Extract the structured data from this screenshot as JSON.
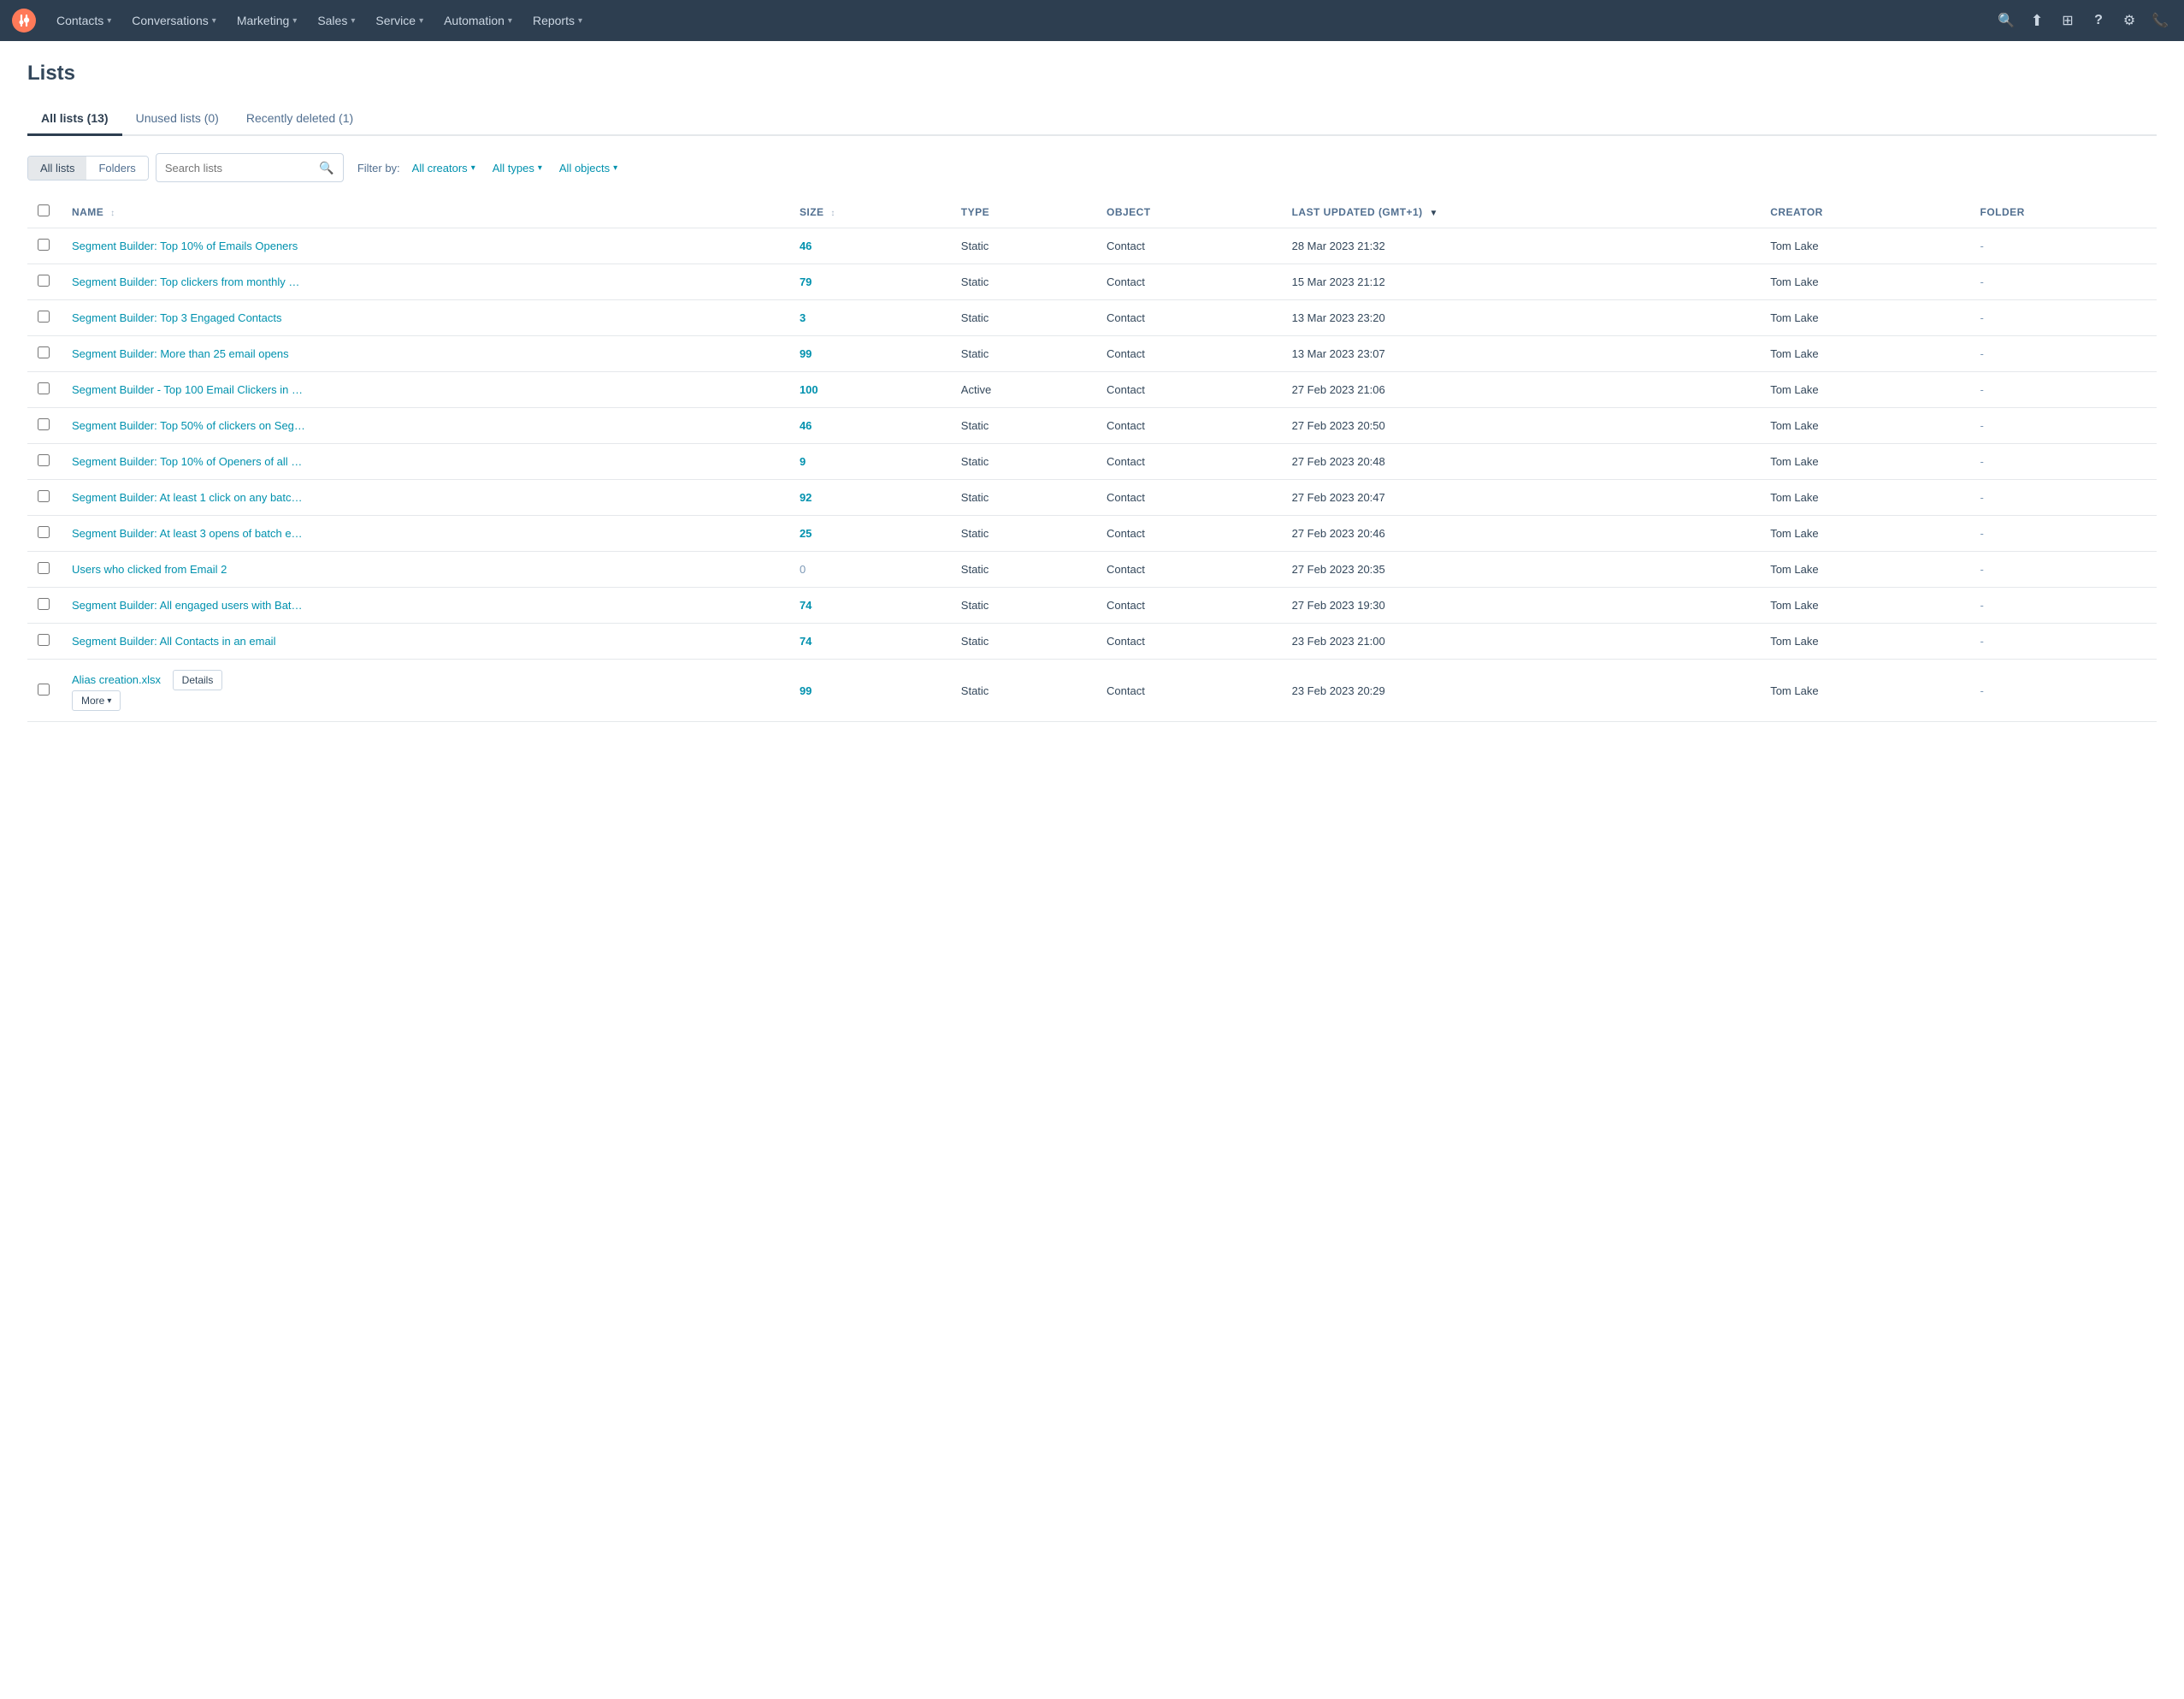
{
  "nav": {
    "logo_title": "HubSpot",
    "items": [
      {
        "label": "Contacts",
        "has_dropdown": true
      },
      {
        "label": "Conversations",
        "has_dropdown": true
      },
      {
        "label": "Marketing",
        "has_dropdown": true
      },
      {
        "label": "Sales",
        "has_dropdown": true
      },
      {
        "label": "Service",
        "has_dropdown": true
      },
      {
        "label": "Automation",
        "has_dropdown": true
      },
      {
        "label": "Reports",
        "has_dropdown": true
      }
    ],
    "icons": [
      {
        "name": "search-icon",
        "symbol": "🔍"
      },
      {
        "name": "upgrade-icon",
        "symbol": "⬆"
      },
      {
        "name": "marketplace-icon",
        "symbol": "⊞"
      },
      {
        "name": "help-icon",
        "symbol": "?"
      },
      {
        "name": "settings-icon",
        "symbol": "⚙"
      },
      {
        "name": "phone-icon",
        "symbol": "📞"
      }
    ]
  },
  "page": {
    "title": "Lists",
    "tabs": [
      {
        "label": "All lists (13)",
        "active": true
      },
      {
        "label": "Unused lists (0)",
        "active": false
      },
      {
        "label": "Recently deleted (1)",
        "active": false
      }
    ]
  },
  "toolbar": {
    "view_all_label": "All lists",
    "view_folders_label": "Folders",
    "search_placeholder": "Search lists",
    "filter_label": "Filter by:",
    "filter_creators": "All creators",
    "filter_types": "All types",
    "filter_objects": "All objects"
  },
  "table": {
    "columns": [
      {
        "label": "NAME",
        "sortable": true,
        "sorted": false
      },
      {
        "label": "SIZE",
        "sortable": true,
        "sorted": false
      },
      {
        "label": "TYPE",
        "sortable": false,
        "sorted": false
      },
      {
        "label": "OBJECT",
        "sortable": false,
        "sorted": false
      },
      {
        "label": "LAST UPDATED (GMT+1)",
        "sortable": true,
        "sorted": true
      },
      {
        "label": "CREATOR",
        "sortable": false,
        "sorted": false
      },
      {
        "label": "FOLDER",
        "sortable": false,
        "sorted": false
      }
    ],
    "rows": [
      {
        "name": "Segment Builder: Top 10% of Emails Openers",
        "size": "46",
        "type": "Static",
        "object": "Contact",
        "last_updated": "28 Mar 2023 21:32",
        "creator": "Tom Lake",
        "folder": "-",
        "show_actions": false
      },
      {
        "name": "Segment Builder: Top clickers from monthly …",
        "size": "79",
        "type": "Static",
        "object": "Contact",
        "last_updated": "15 Mar 2023 21:12",
        "creator": "Tom Lake",
        "folder": "-",
        "show_actions": false
      },
      {
        "name": "Segment Builder: Top 3 Engaged Contacts",
        "size": "3",
        "type": "Static",
        "object": "Contact",
        "last_updated": "13 Mar 2023 23:20",
        "creator": "Tom Lake",
        "folder": "-",
        "show_actions": false
      },
      {
        "name": "Segment Builder: More than 25 email opens",
        "size": "99",
        "type": "Static",
        "object": "Contact",
        "last_updated": "13 Mar 2023 23:07",
        "creator": "Tom Lake",
        "folder": "-",
        "show_actions": false
      },
      {
        "name": "Segment Builder - Top 100 Email Clickers in …",
        "size": "100",
        "type": "Active",
        "object": "Contact",
        "last_updated": "27 Feb 2023 21:06",
        "creator": "Tom Lake",
        "folder": "-",
        "show_actions": false
      },
      {
        "name": "Segment Builder: Top 50% of clickers on Seg…",
        "size": "46",
        "type": "Static",
        "object": "Contact",
        "last_updated": "27 Feb 2023 20:50",
        "creator": "Tom Lake",
        "folder": "-",
        "show_actions": false
      },
      {
        "name": "Segment Builder: Top 10% of Openers of all …",
        "size": "9",
        "type": "Static",
        "object": "Contact",
        "last_updated": "27 Feb 2023 20:48",
        "creator": "Tom Lake",
        "folder": "-",
        "show_actions": false
      },
      {
        "name": "Segment Builder: At least 1 click on any batc…",
        "size": "92",
        "type": "Static",
        "object": "Contact",
        "last_updated": "27 Feb 2023 20:47",
        "creator": "Tom Lake",
        "folder": "-",
        "show_actions": false
      },
      {
        "name": "Segment Builder: At least 3 opens of batch e…",
        "size": "25",
        "type": "Static",
        "object": "Contact",
        "last_updated": "27 Feb 2023 20:46",
        "creator": "Tom Lake",
        "folder": "-",
        "show_actions": false
      },
      {
        "name": "Users who clicked from Email 2",
        "size": "0",
        "type": "Static",
        "object": "Contact",
        "last_updated": "27 Feb 2023 20:35",
        "creator": "Tom Lake",
        "folder": "-",
        "show_actions": false
      },
      {
        "name": "Segment Builder: All engaged users with Bat…",
        "size": "74",
        "type": "Static",
        "object": "Contact",
        "last_updated": "27 Feb 2023 19:30",
        "creator": "Tom Lake",
        "folder": "-",
        "show_actions": false
      },
      {
        "name": "Segment Builder: All Contacts in an email",
        "size": "74",
        "type": "Static",
        "object": "Contact",
        "last_updated": "23 Feb 2023 21:00",
        "creator": "Tom Lake",
        "folder": "-",
        "show_actions": false
      },
      {
        "name": "Alias creation.xlsx",
        "size": "99",
        "type": "Static",
        "object": "Contact",
        "last_updated": "23 Feb 2023 20:29",
        "creator": "Tom Lake",
        "folder": "-",
        "show_actions": true,
        "action_details": "Details",
        "action_more": "More"
      }
    ]
  }
}
